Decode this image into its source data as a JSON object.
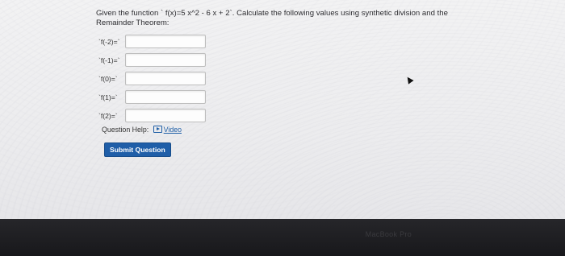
{
  "question": {
    "text": "Given the function ` f(x)=5 x^2 - 6 x + 2`. Calculate the following values using synthetic division and the Remainder Theorem:"
  },
  "rows": [
    {
      "label": "`f(-2)=`",
      "value": ""
    },
    {
      "label": "`f(-1)=`",
      "value": ""
    },
    {
      "label": "`f(0)=`",
      "value": ""
    },
    {
      "label": "`f(1)=`",
      "value": ""
    },
    {
      "label": "`f(2)=`",
      "value": ""
    }
  ],
  "help": {
    "label": "Question Help:",
    "video_label": "Video"
  },
  "submit_label": "Submit Question",
  "bezel": {
    "brand": "MacBook Pro"
  }
}
